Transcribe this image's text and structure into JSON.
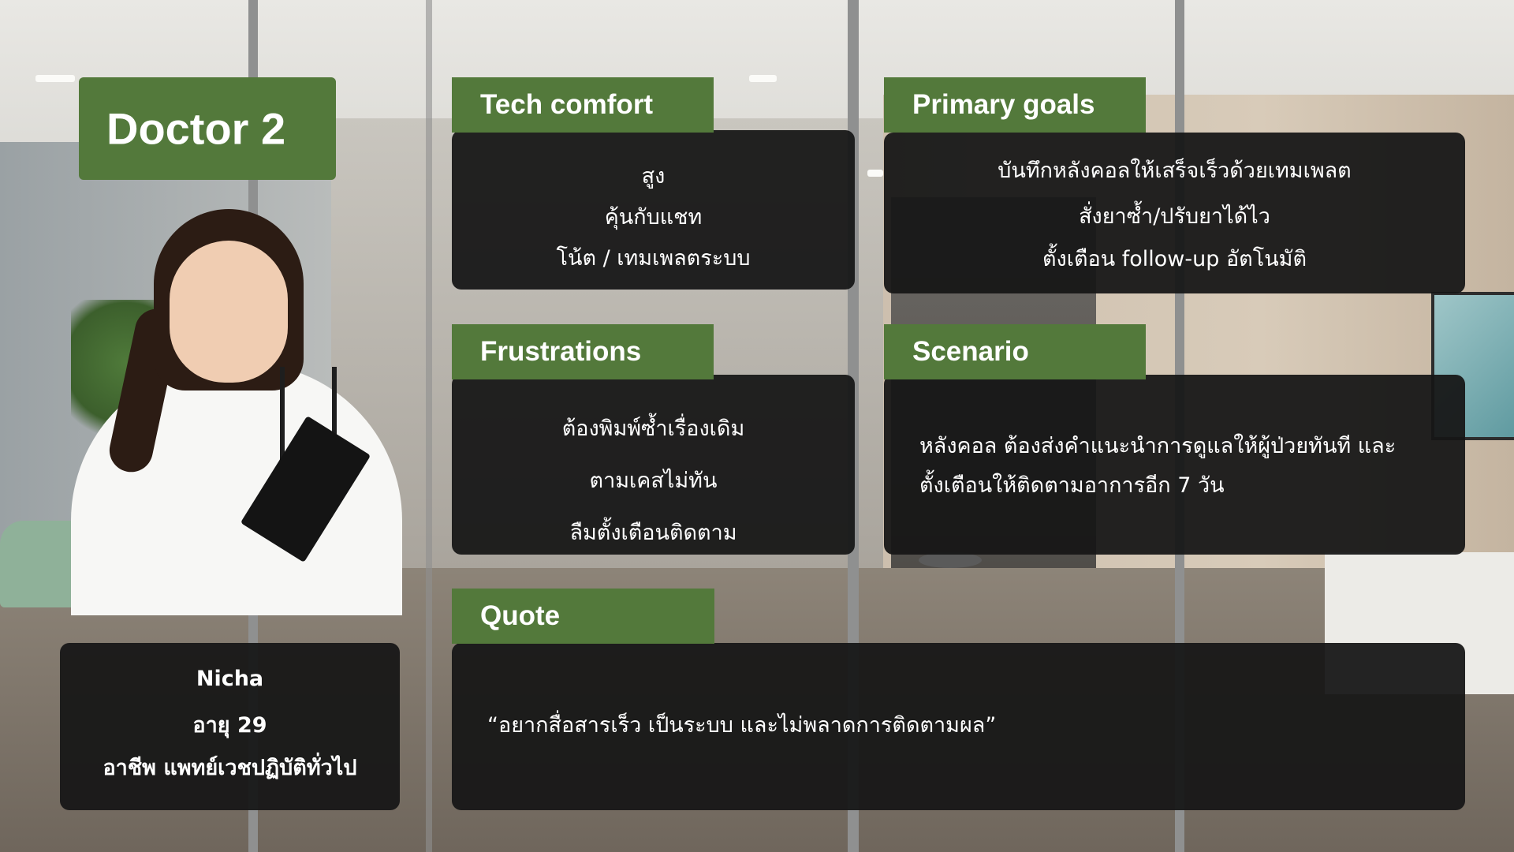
{
  "persona": {
    "title": "Doctor 2"
  },
  "profile": {
    "name": "Nicha",
    "age": "อายุ  29",
    "occupation": "อาชีพ  แพทย์เวชปฏิบัติทั่วไป"
  },
  "tech_comfort": {
    "heading": "Tech comfort",
    "items": [
      "สูง",
      "คุ้นกับแชท",
      "โน้ต / เทมเพลตระบบ"
    ]
  },
  "primary_goals": {
    "heading": "Primary goals",
    "items": [
      "บันทึกหลังคอลให้เสร็จเร็วด้วยเทมเพลต",
      "สั่งยาซ้ำ/ปรับยาได้ไว",
      "ตั้งเตือน follow-up อัตโนมัติ"
    ]
  },
  "frustrations": {
    "heading": "Frustrations",
    "items": [
      "ต้องพิมพ์ซ้ำเรื่องเดิม",
      "ตามเคสไม่ทัน",
      "ลืมตั้งเตือนติดตาม"
    ]
  },
  "scenario": {
    "heading": "Scenario",
    "lines": [
      "หลังคอล ต้องส่งคำแนะนำการดูแลให้ผู้ป่วยทันที และ",
      "ตั้งเตือนให้ติดตามอาการอีก 7 วัน"
    ]
  },
  "quote": {
    "heading": "Quote",
    "text": "“อยากสื่อสารเร็ว เป็นระบบ และไม่พลาดการติดตามผล”"
  },
  "colors": {
    "accent_green": "#53793b",
    "panel_dark": "#161616",
    "text": "#ffffff"
  },
  "background_image": "clinic-corridor-photo",
  "portrait_image": "doctor-portrait-photo"
}
